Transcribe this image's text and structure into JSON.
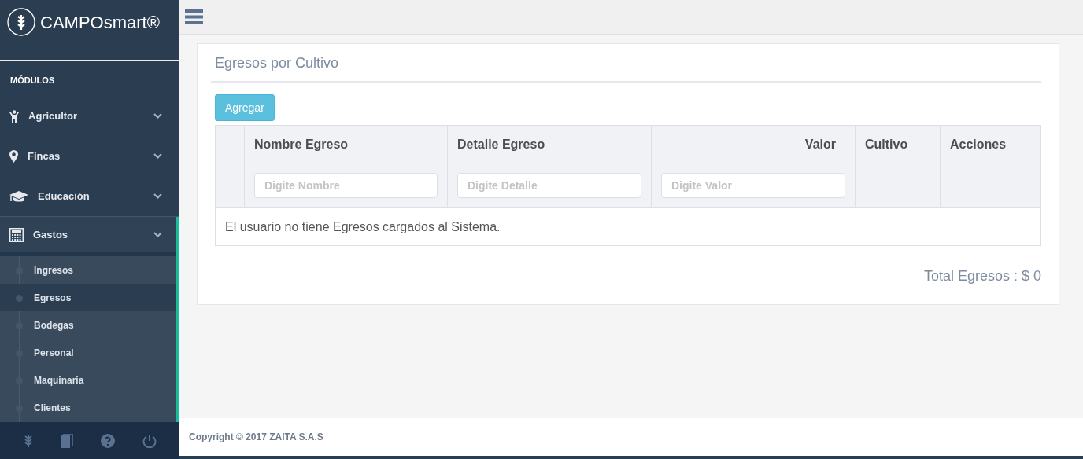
{
  "brand": {
    "name": "CAMPOsmart®"
  },
  "sidebar": {
    "section_label": "MÓDULOS",
    "items": [
      {
        "label": "Agricultor",
        "expanded": false
      },
      {
        "label": "Fincas",
        "expanded": false
      },
      {
        "label": "Educación",
        "expanded": false
      },
      {
        "label": "Gastos",
        "expanded": true,
        "children": [
          {
            "label": "Ingresos",
            "selected": false
          },
          {
            "label": "Egresos",
            "selected": true
          },
          {
            "label": "Bodegas",
            "selected": false
          },
          {
            "label": "Personal",
            "selected": false
          },
          {
            "label": "Maquinaria",
            "selected": false
          },
          {
            "label": "Clientes",
            "selected": false
          }
        ]
      }
    ]
  },
  "panel": {
    "title": "Egresos por Cultivo",
    "add_button": "Agregar",
    "table": {
      "columns": [
        {
          "kind": "blank"
        },
        {
          "kind": "text",
          "label": "Nombre Egreso"
        },
        {
          "kind": "text",
          "label": "Detalle Egreso"
        },
        {
          "kind": "number",
          "label": "Valor"
        },
        {
          "kind": "text",
          "label": "Cultivo"
        },
        {
          "kind": "text",
          "label": "Acciones"
        }
      ],
      "filters": [
        {
          "kind": "blank"
        },
        {
          "kind": "input",
          "placeholder": "Digite Nombre"
        },
        {
          "kind": "input",
          "placeholder": "Digite Detalle"
        },
        {
          "kind": "input",
          "placeholder": "Digite Valor"
        },
        {
          "kind": "blank"
        },
        {
          "kind": "blank"
        }
      ],
      "empty_message": "El usuario no tiene Egresos cargados al Sistema."
    },
    "total": "Total Egresos : $ 0"
  },
  "footer": {
    "copyright": "Copyright © 2017 ZAITA S.A.S"
  }
}
